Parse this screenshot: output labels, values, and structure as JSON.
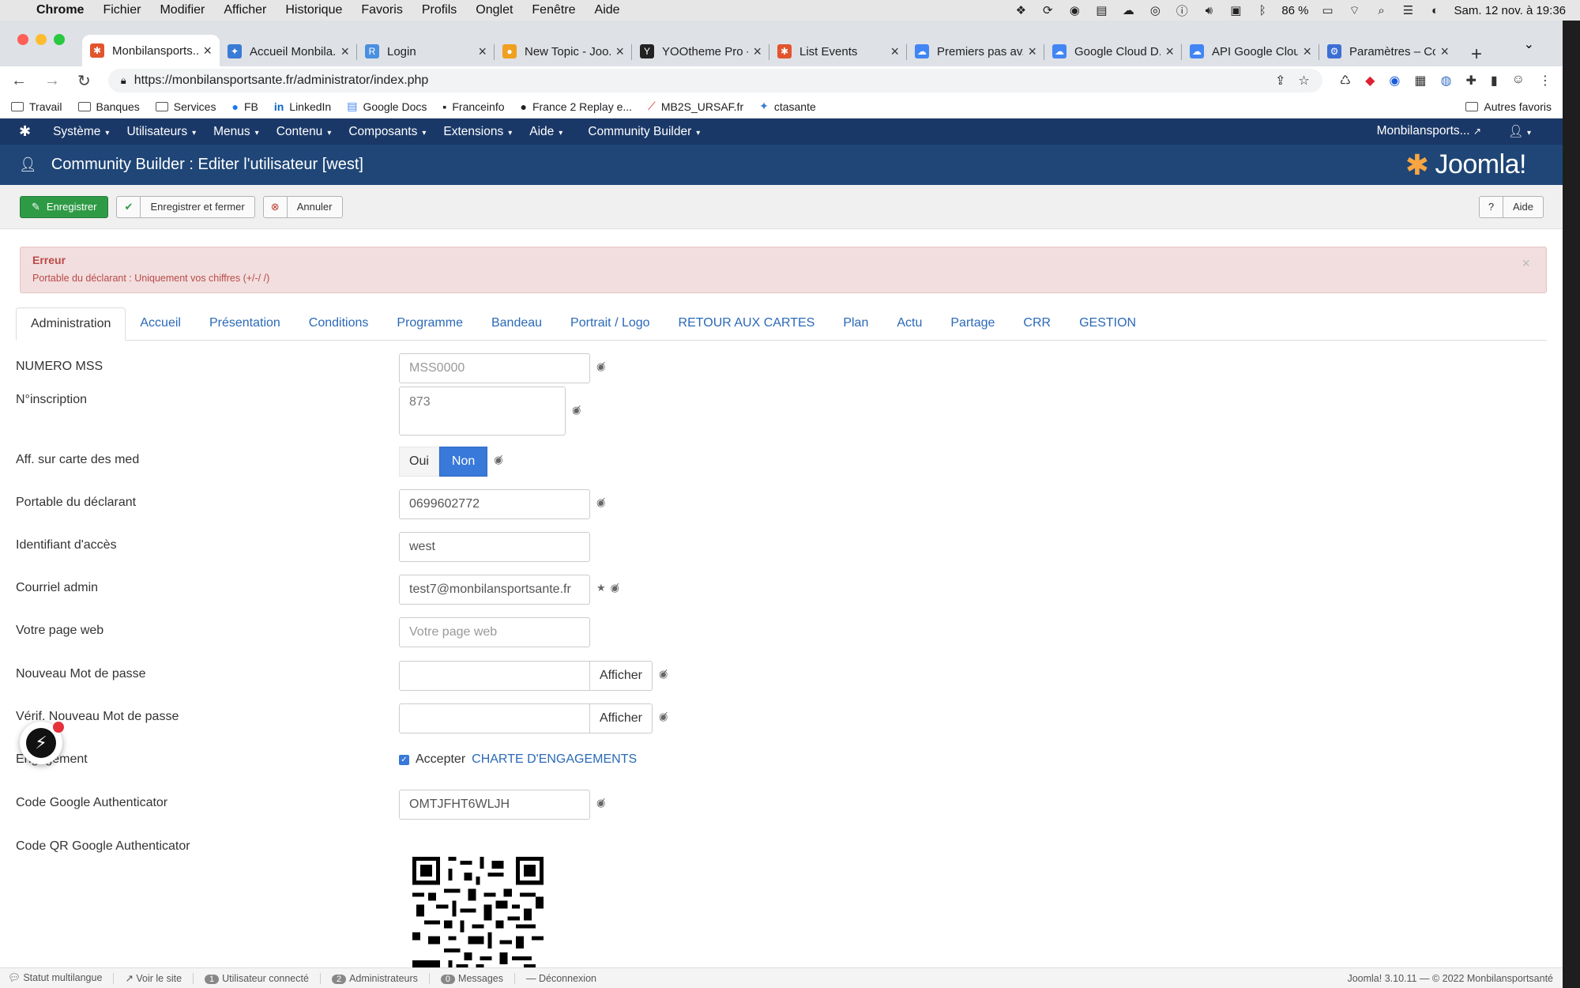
{
  "mac": {
    "app": "Chrome",
    "menus": [
      "Fichier",
      "Modifier",
      "Afficher",
      "Historique",
      "Favoris",
      "Profils",
      "Onglet",
      "Fenêtre",
      "Aide"
    ],
    "battery": "86 %",
    "clock": "Sam. 12 nov. à 19:36"
  },
  "browser": {
    "tabs": [
      {
        "title": "Monbilansports...",
        "color": "#e2542d",
        "icon": "joomla-icon",
        "active": true
      },
      {
        "title": "Accueil Monbila...",
        "color": "#3a7bd5",
        "icon": "runner-icon"
      },
      {
        "title": "Login",
        "color": "#4a8fe0",
        "icon": "rs-icon"
      },
      {
        "title": "New Topic - Joo...",
        "color": "#f0a020",
        "icon": "forum-icon"
      },
      {
        "title": "YOOtheme Pro -...",
        "color": "#222222",
        "icon": "yoo-icon"
      },
      {
        "title": "List Events",
        "color": "#e2542d",
        "icon": "joomla-icon"
      },
      {
        "title": "Premiers pas av...",
        "color": "#4285f4",
        "icon": "gcloud-icon"
      },
      {
        "title": "Google Cloud D...",
        "color": "#4285f4",
        "icon": "gcloud-icon"
      },
      {
        "title": "API Google Clou...",
        "color": "#4285f4",
        "icon": "gcloud-icon"
      },
      {
        "title": "Paramètres – Co...",
        "color": "#3b6fd4",
        "icon": "gear-icon"
      }
    ],
    "url": "https://monbilansportsante.fr/administrator/index.php",
    "bookmarks": [
      "Travail",
      "Banques",
      "Services",
      "FB",
      "LinkedIn",
      "Google Docs",
      "Franceinfo",
      "France 2 Replay e...",
      "MB2S_URSAF.fr",
      "ctasante"
    ],
    "other_bookmarks": "Autres favoris"
  },
  "joomla": {
    "menu": [
      "Système",
      "Utilisateurs",
      "Menus",
      "Contenu",
      "Composants",
      "Extensions",
      "Aide",
      "Community Builder"
    ],
    "site_link": "Monbilansports...",
    "page_title": "Community Builder : Editer l'utilisateur [west]",
    "brand": "Joomla!",
    "toolbar": {
      "save": "Enregistrer",
      "save_close": "Enregistrer et fermer",
      "cancel": "Annuler",
      "help": "Aide"
    },
    "alert": {
      "heading": "Erreur",
      "message": "Portable du déclarant : Uniquement vos chiffres (+/-/ /)"
    },
    "tabs": [
      "Administration",
      "Accueil",
      "Présentation",
      "Conditions",
      "Programme",
      "Bandeau",
      "Portrait / Logo",
      "RETOUR AUX CARTES",
      "Plan",
      "Actu",
      "Partage",
      "CRR",
      "GESTION"
    ],
    "fields": {
      "numero_mss": {
        "label": "NUMERO MSS",
        "placeholder": "MSS0000"
      },
      "inscription": {
        "label": "N°inscription",
        "value": "873"
      },
      "carte": {
        "label": "Aff. sur carte des med",
        "yes": "Oui",
        "no": "Non"
      },
      "portable": {
        "label": "Portable du déclarant",
        "value": "0699602772"
      },
      "identifiant": {
        "label": "Identifiant d'accès",
        "value": "west"
      },
      "courriel": {
        "label": "Courriel admin",
        "value": "test7@monbilansportsante.fr"
      },
      "page_web": {
        "label": "Votre page web",
        "placeholder": "Votre page web"
      },
      "nouveau_mdp": {
        "label": "Nouveau Mot de passe",
        "button": "Afficher"
      },
      "verif_mdp": {
        "label": "Vérif. Nouveau Mot de passe",
        "button": "Afficher"
      },
      "engagement": {
        "label": "Engagement",
        "accept": "Accepter",
        "link": "CHARTE D'ENGAGEMENTS"
      },
      "ga_code": {
        "label": "Code Google Authenticator",
        "value": "OMTJFHT6WLJH"
      },
      "ga_qr": {
        "label": "Code QR Google Authenticator"
      }
    },
    "status": {
      "multilang": "Statut multilangue",
      "view_site": "Voir le site",
      "users_count": "1",
      "users_label": "Utilisateur connecté",
      "admins_count": "2",
      "admins_label": "Administrateurs",
      "messages_count": "0",
      "messages_label": "Messages",
      "logout": "Déconnexion",
      "version": "Joomla! 3.10.11  —  © 2022 Monbilansportsanté"
    }
  }
}
